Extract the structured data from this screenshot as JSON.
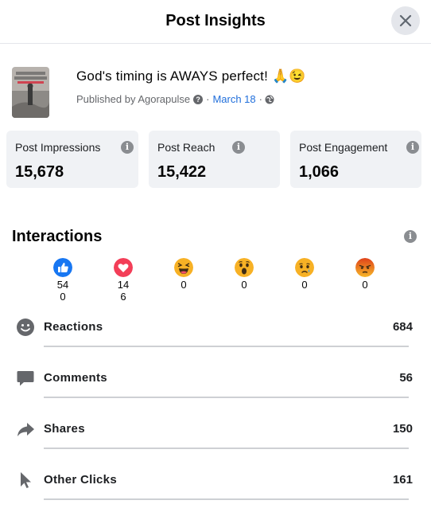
{
  "header": {
    "title": "Post Insights",
    "close_icon": "close-icon"
  },
  "post": {
    "title": "God's timing is AWAYS perfect! 🙏😉",
    "published_by": "Published by Agorapulse",
    "date": "March 18",
    "thumbnail_text": [
      "Don't worry…",
      "God's timing is",
      "always perfect"
    ]
  },
  "stats": [
    {
      "label": "Post Impressions",
      "value": "15,678"
    },
    {
      "label": "Post Reach",
      "value": "15,422"
    },
    {
      "label": "Post Engagement",
      "value": "1,066"
    }
  ],
  "interactions": {
    "title": "Interactions",
    "reactions": [
      {
        "icon": "like-icon",
        "count": "540"
      },
      {
        "icon": "love-icon",
        "count": "146"
      },
      {
        "icon": "haha-icon",
        "count": "0"
      },
      {
        "icon": "wow-icon",
        "count": "0"
      },
      {
        "icon": "sad-icon",
        "count": "0"
      },
      {
        "icon": "angry-icon",
        "count": "0"
      }
    ],
    "rows": [
      {
        "icon": "smiley-icon",
        "label": "Reactions",
        "value": "684"
      },
      {
        "icon": "comment-icon",
        "label": "Comments",
        "value": "56"
      },
      {
        "icon": "share-icon",
        "label": "Shares",
        "value": "150"
      },
      {
        "icon": "cursor-icon",
        "label": "Other Clicks",
        "value": "161"
      }
    ]
  },
  "colors": {
    "link": "#216fdb",
    "card_bg": "#f0f2f5",
    "like_blue": "#1877f2",
    "love_red": "#f33e58",
    "emoji_yellow": "#f7b125",
    "angry_orange": "#e9710f"
  }
}
